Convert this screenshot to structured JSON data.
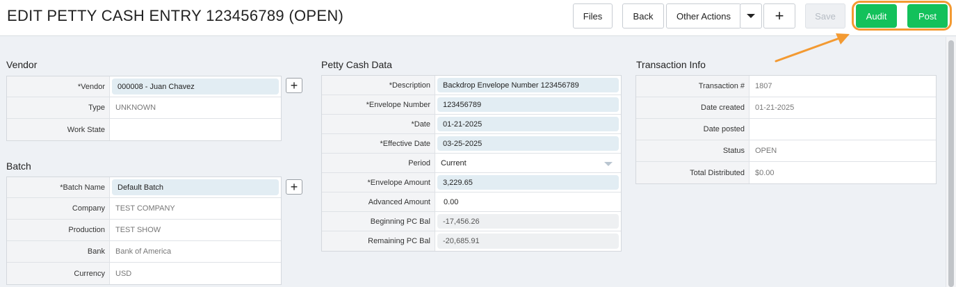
{
  "header": {
    "title": "EDIT PETTY CASH ENTRY 123456789 (OPEN)",
    "buttons": {
      "files": "Files",
      "back": "Back",
      "other_actions": "Other Actions",
      "save": "Save",
      "audit": "Audit",
      "post": "Post"
    },
    "icons": {
      "add": "plus-icon",
      "dropdown": "caret-down-icon"
    },
    "accent_color": "#13c15b",
    "highlight_color": "#f39a32"
  },
  "vendor": {
    "title": "Vendor",
    "rows": [
      {
        "label": "*Vendor",
        "value": "000008 - Juan Chavez"
      },
      {
        "label": "Type",
        "value": "UNKNOWN"
      },
      {
        "label": "Work State",
        "value": ""
      }
    ]
  },
  "batch": {
    "title": "Batch",
    "rows": [
      {
        "label": "*Batch Name",
        "value": "Default Batch"
      },
      {
        "label": "Company",
        "value": "TEST COMPANY"
      },
      {
        "label": "Production",
        "value": "TEST SHOW"
      },
      {
        "label": "Bank",
        "value": "Bank of America"
      },
      {
        "label": "Currency",
        "value": "USD"
      }
    ]
  },
  "petty_cash": {
    "title": "Petty Cash Data",
    "rows": [
      {
        "label": "*Description",
        "value": "Backdrop Envelope Number 123456789"
      },
      {
        "label": "*Envelope Number",
        "value": "123456789"
      },
      {
        "label": "*Date",
        "value": "01-21-2025"
      },
      {
        "label": "*Effective Date",
        "value": "03-25-2025"
      },
      {
        "label": "Period",
        "value": "Current"
      },
      {
        "label": "*Envelope Amount",
        "value": "3,229.65"
      },
      {
        "label": "Advanced Amount",
        "value": "0.00"
      },
      {
        "label": "Beginning PC Bal",
        "value": "-17,456.26"
      },
      {
        "label": "Remaining PC Bal",
        "value": "-20,685.91"
      }
    ]
  },
  "transaction": {
    "title": "Transaction Info",
    "rows": [
      {
        "label": "Transaction #",
        "value": "1807"
      },
      {
        "label": "Date created",
        "value": "01-21-2025"
      },
      {
        "label": "Date posted",
        "value": ""
      },
      {
        "label": "Status",
        "value": "OPEN"
      },
      {
        "label": "Total Distributed",
        "value": "$0.00"
      }
    ]
  }
}
